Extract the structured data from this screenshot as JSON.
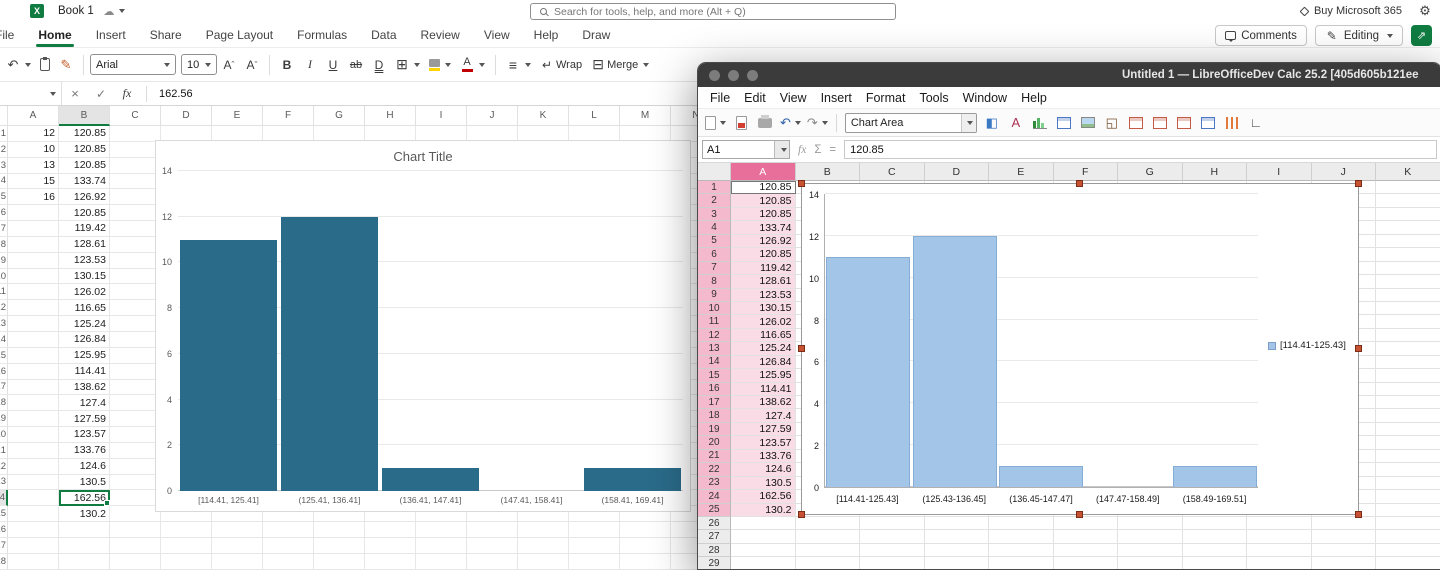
{
  "colors": {
    "excel_green": "#107C41",
    "excel_bar": "#2a6b89",
    "libre_accent_pink": "#e86f99",
    "libre_selection_fill": "#f9dce6",
    "libre_bar": "#a3c6e8",
    "libre_handle": "#c75133"
  },
  "excel": {
    "topbar": {
      "doc_title": "Book 1",
      "search_placeholder": "Search for tools, help, and more (Alt + Q)",
      "buy_label": "Buy Microsoft 365"
    },
    "tabs": [
      "File",
      "Home",
      "Insert",
      "Share",
      "Page Layout",
      "Formulas",
      "Data",
      "Review",
      "View",
      "Help",
      "Draw"
    ],
    "active_tab": "Home",
    "ribbon_right": {
      "comments_label": "Comments",
      "editing_label": "Editing"
    },
    "toolbar": {
      "font_name": "Arial",
      "font_size": "10",
      "wrap_label": "Wrap",
      "merge_label": "Merge"
    },
    "formula_bar": {
      "name_box": "",
      "value": "162.56"
    },
    "grid": {
      "columns": [
        "A",
        "B",
        "C",
        "D",
        "E",
        "F",
        "G",
        "H",
        "I",
        "J",
        "K",
        "L",
        "M",
        "N"
      ],
      "row_count": 28,
      "col_a_values": [
        "12",
        "10",
        "13",
        "15",
        "16"
      ],
      "col_b_values": [
        "120.85",
        "120.85",
        "120.85",
        "133.74",
        "126.92",
        "120.85",
        "119.42",
        "128.61",
        "123.53",
        "130.15",
        "126.02",
        "116.65",
        "125.24",
        "126.84",
        "125.95",
        "114.41",
        "138.62",
        "127.4",
        "127.59",
        "123.57",
        "133.76",
        "124.6",
        "130.5",
        "162.56",
        "130.2"
      ],
      "selected_cell": "B24",
      "selected_column": "B",
      "selected_row": 24
    }
  },
  "libre": {
    "titlebar": {
      "title": "Untitled 1 — LibreOfficeDev Calc 25.2 [405d605b121ee"
    },
    "menus": [
      "File",
      "Edit",
      "View",
      "Insert",
      "Format",
      "Tools",
      "Window",
      "Help"
    ],
    "toolbar": {
      "selector_value": "Chart Area",
      "icons": [
        {
          "name": "new-document-icon",
          "kind": "page",
          "dropdown": true
        },
        {
          "name": "export-pdf-icon",
          "kind": "pdf"
        },
        {
          "name": "print-icon",
          "kind": "printer"
        },
        {
          "name": "undo-icon",
          "kind": "glyph",
          "glyph": "↶",
          "color": "#2f5fa8",
          "dropdown": true
        },
        {
          "name": "redo-icon",
          "kind": "glyph",
          "glyph": "↷",
          "color": "#8a8a8a",
          "dropdown": true
        },
        {
          "name": "toolbar-separator",
          "kind": "sep"
        },
        {
          "name": "chart-element-selector",
          "kind": "combo"
        },
        {
          "name": "format-selection-icon",
          "kind": "glyph",
          "glyph": "◧",
          "color": "#3b78c4"
        },
        {
          "name": "character-dialog-icon",
          "kind": "glyph",
          "glyph": "A",
          "color": "#a83250"
        },
        {
          "name": "chart-type-icon",
          "kind": "bars"
        },
        {
          "name": "chart-data-table-icon",
          "kind": "grid",
          "accent": "#4a76c4"
        },
        {
          "name": "insert-image-icon",
          "kind": "photo"
        },
        {
          "name": "chart-floor-icon",
          "kind": "glyph",
          "glyph": "◱",
          "color": "#7a5230"
        },
        {
          "name": "data-ranges-icon",
          "kind": "grid",
          "accent": "#c25a45"
        },
        {
          "name": "insert-row-icon",
          "kind": "grid",
          "accent": "#c25a45"
        },
        {
          "name": "insert-column-icon",
          "kind": "grid",
          "accent": "#c25a45"
        },
        {
          "name": "legend-toggle-icon",
          "kind": "grid",
          "accent": "#4a76c4"
        },
        {
          "name": "vertical-grids-icon",
          "kind": "vbars"
        },
        {
          "name": "axes-icon",
          "kind": "glyph",
          "glyph": "∟",
          "color": "#555555"
        }
      ]
    },
    "formula_bar": {
      "name_box": "A1",
      "value": "120.85"
    },
    "grid": {
      "columns": [
        "A",
        "B",
        "C",
        "D",
        "E",
        "F",
        "G",
        "H",
        "I",
        "J",
        "K"
      ],
      "row_count": 29,
      "selected_rows": 25,
      "col_a_values": [
        "120.85",
        "120.85",
        "120.85",
        "133.74",
        "126.92",
        "120.85",
        "119.42",
        "128.61",
        "123.53",
        "130.15",
        "126.02",
        "116.65",
        "125.24",
        "126.84",
        "125.95",
        "114.41",
        "138.62",
        "127.4",
        "127.59",
        "123.57",
        "133.76",
        "124.6",
        "130.5",
        "162.56",
        "130.2"
      ]
    }
  },
  "chart_data": [
    {
      "id": "excel-histogram",
      "type": "bar",
      "title": "Chart Title",
      "categories": [
        "[114.41, 125.41]",
        "(125.41, 136.41]",
        "(136.41, 147.41]",
        "(147.41, 158.41]",
        "(158.41, 169.41]"
      ],
      "values": [
        11,
        12,
        1,
        0,
        1
      ],
      "xlabel": "",
      "ylabel": "",
      "ylim": [
        0,
        14
      ],
      "yticks": [
        0,
        2,
        4,
        6,
        8,
        10,
        12,
        14
      ],
      "grid": true,
      "legend": null,
      "bar_color": "#2a6b89"
    },
    {
      "id": "libreoffice-histogram",
      "type": "bar",
      "title": "",
      "categories": [
        "[114.41-125.43]",
        "(125.43-136.45]",
        "(136.45-147.47]",
        "(147.47-158.49]",
        "(158.49-169.51]"
      ],
      "values": [
        11,
        12,
        1,
        0,
        1
      ],
      "xlabel": "",
      "ylabel": "",
      "ylim": [
        0,
        14
      ],
      "yticks": [
        0,
        2,
        4,
        6,
        8,
        10,
        12,
        14
      ],
      "grid": true,
      "legend": {
        "label": "[114.41-125.43]",
        "position": "right"
      },
      "bar_color": "#a3c6e8"
    }
  ]
}
